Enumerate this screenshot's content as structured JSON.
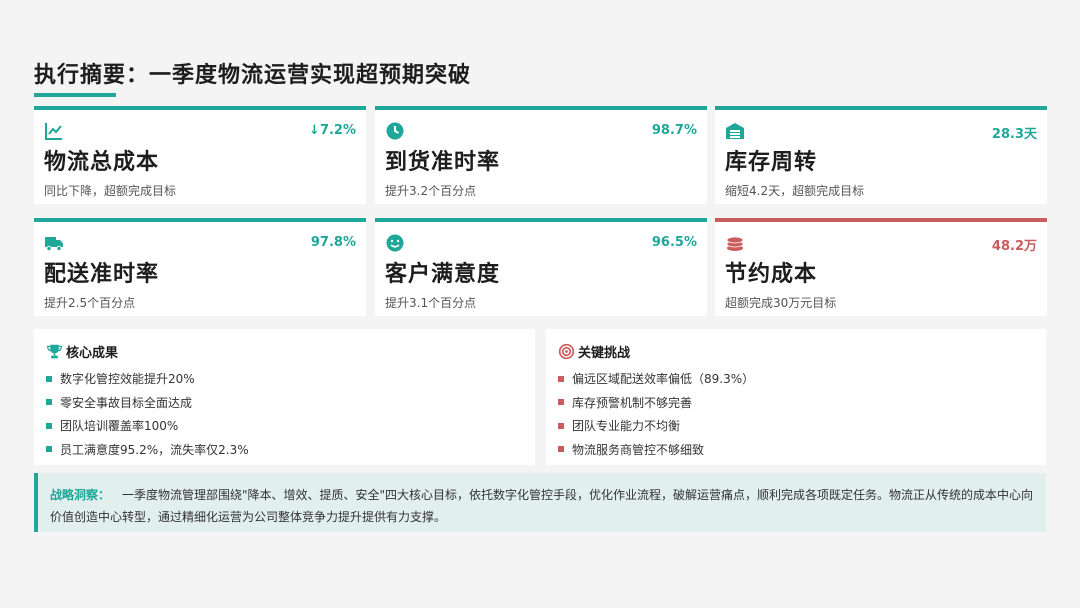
{
  "title": "执行摘要：一季度物流运营实现超预期突破",
  "colors": {
    "accent": "#1fa79a",
    "alert": "#c95c5c"
  },
  "cards": [
    {
      "icon": "line-chart-icon",
      "value": "↓7.2%",
      "name": "物流总成本",
      "sub": "同比下降，超额完成目标"
    },
    {
      "icon": "clock-icon",
      "value": "98.7%",
      "name": "到货准时率",
      "sub": "提升3.2个百分点"
    },
    {
      "icon": "warehouse-icon",
      "value": "28.3天",
      "name": "库存周转",
      "sub": "缩短4.2天，超额完成目标"
    },
    {
      "icon": "truck-icon",
      "value": "97.8%",
      "name": "配送准时率",
      "sub": "提升2.5个百分点"
    },
    {
      "icon": "smile-icon",
      "value": "96.5%",
      "name": "客户满意度",
      "sub": "提升3.1个百分点"
    },
    {
      "icon": "coins-icon",
      "value": "48.2万",
      "name": "节约成本",
      "sub": "超额完成30万元目标"
    }
  ],
  "achievements": {
    "icon": "trophy-icon",
    "title": "核心成果",
    "items": [
      "数字化管控效能提升20%",
      "零安全事故目标全面达成",
      "团队培训覆盖率100%",
      "员工满意度95.2%，流失率仅2.3%"
    ]
  },
  "challenges": {
    "icon": "target-icon",
    "title": "关键挑战",
    "items": [
      "偏远区域配送效率偏低（89.3%）",
      "库存预警机制不够完善",
      "团队专业能力不均衡",
      "物流服务商管控不够细致"
    ]
  },
  "strategy": {
    "label": "战略洞察：",
    "text": "一季度物流管理部围绕\"降本、增效、提质、安全\"四大核心目标，依托数字化管控手段，优化作业流程，破解运营痛点，顺利完成各项既定任务。物流正从传统的成本中心向价值创造中心转型，通过精细化运营为公司整体竞争力提升提供有力支撑。"
  }
}
